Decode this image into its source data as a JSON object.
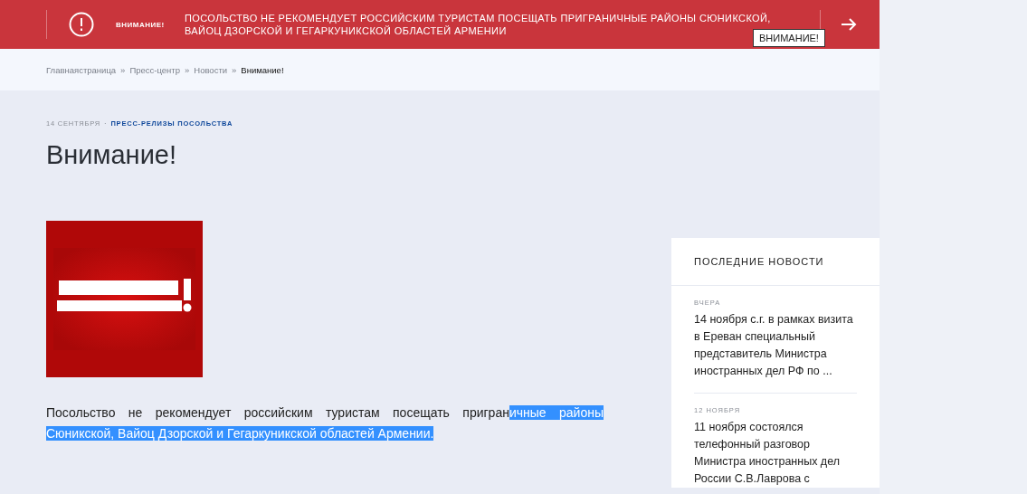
{
  "alert_bar": {
    "label": "ВНИМАНИЕ!",
    "message": "ПОСОЛЬСТВО НЕ РЕКОМЕНДУЕТ РОССИЙСКИМ ТУРИСТАМ ПОСЕЩАТЬ ПРИГРАНИЧНЫЕ РАЙОНЫ СЮНИКСКОЙ, ВАЙОЦ ДЗОРСКОЙ И ГЕГАРКУНИКСКОЙ ОБЛАСТЕЙ АРМЕНИИ",
    "tooltip": "ВНИМАНИЕ!"
  },
  "breadcrumbs": [
    {
      "label": "Главнаястраница",
      "current": false
    },
    {
      "label": "Пресс-центр",
      "current": false
    },
    {
      "label": "Новости",
      "current": false
    },
    {
      "label": "Внимание!",
      "current": true
    }
  ],
  "breadcrumb_separator": "»",
  "meta_separator": "·",
  "article": {
    "date": "14 СЕНТЯБРЯ",
    "category": "ПРЕСС-РЕЛИЗЫ ПОСОЛЬСТВА",
    "title": "Внимание!",
    "body": {
      "text": "Посольство не рекомендует российским туристам посещать пригран",
      "highlighted": "ичные районы Сюникской, Вайоц Дзорской и Гегаркуникской областей Армении."
    }
  },
  "sidebar": {
    "title": "ПОСЛЕДНИЕ НОВОСТИ",
    "items": [
      {
        "date": "ВЧЕРА",
        "text": "14 ноября с.г. в рамках визита в Ереван специальный представитель Министра иностранных дел РФ по ..."
      },
      {
        "date": "12 НОЯБРЯ",
        "text": "11 ноября состоялся телефонный разговор Министра иностранных дел России С.В.Лаврова с"
      }
    ]
  }
}
